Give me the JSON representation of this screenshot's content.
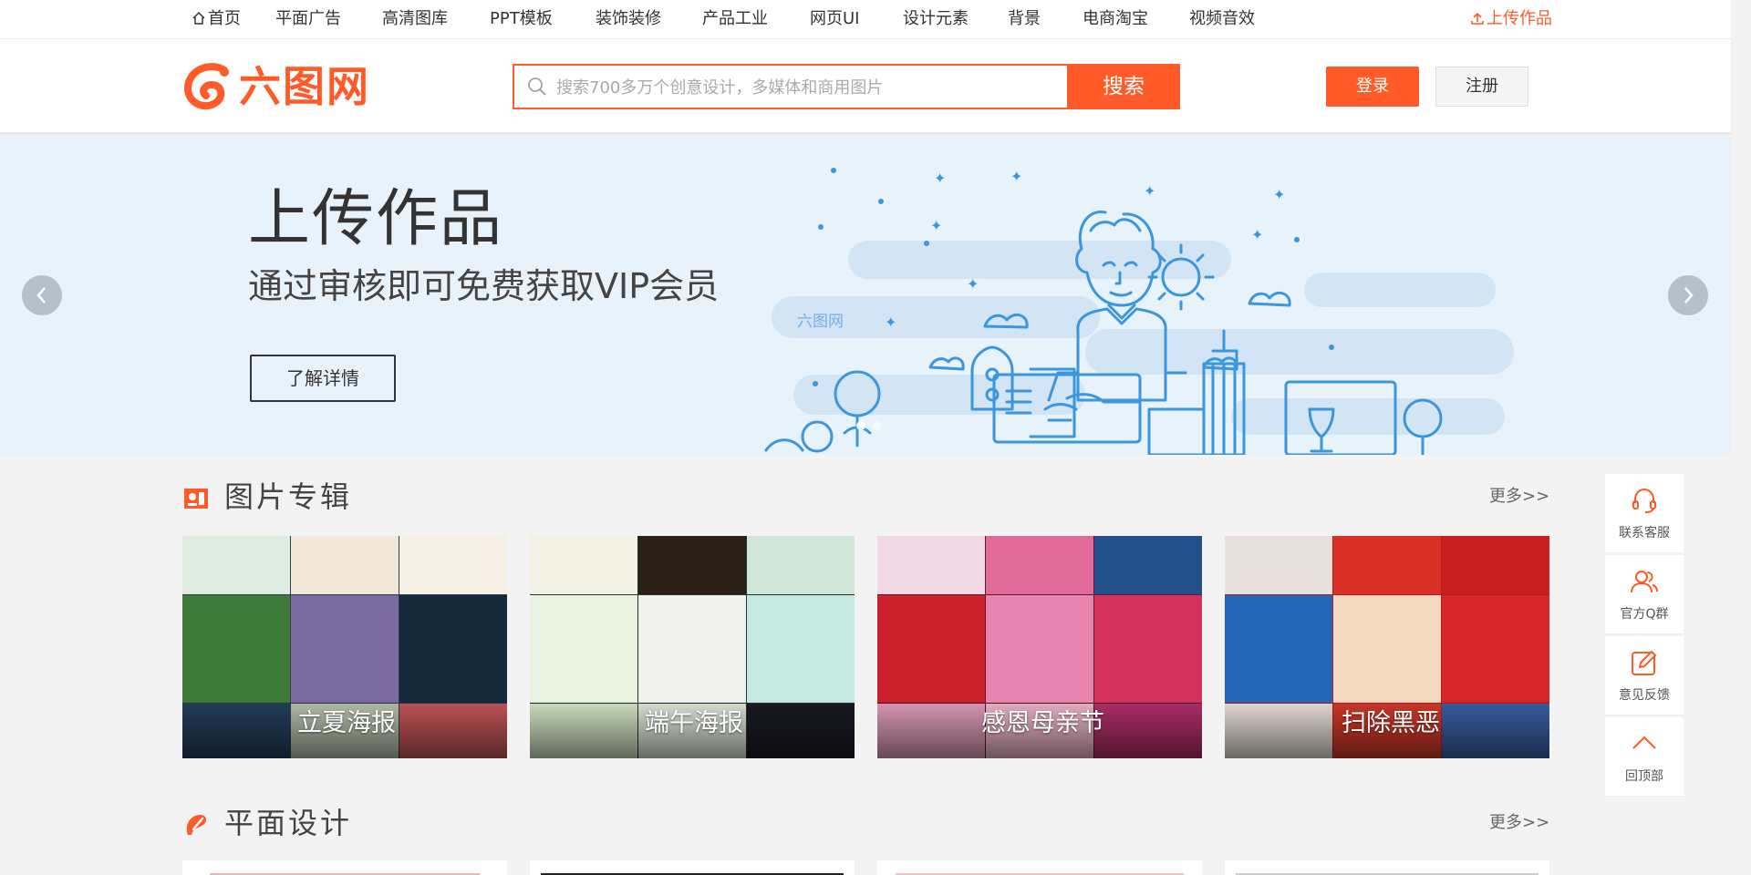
{
  "nav": {
    "items": [
      {
        "label": "首页"
      },
      {
        "label": "平面广告"
      },
      {
        "label": "高清图库"
      },
      {
        "label": "PPT模板"
      },
      {
        "label": "装饰装修"
      },
      {
        "label": "产品工业"
      },
      {
        "label": "网页UI"
      },
      {
        "label": "设计元素"
      },
      {
        "label": "背景"
      },
      {
        "label": "电商淘宝"
      },
      {
        "label": "视频音效"
      }
    ],
    "upload_label": "上传作品"
  },
  "header": {
    "logo_text": "六图网",
    "search_placeholder": "搜索700多万个创意设计，多媒体和商用图片",
    "search_button": "搜索",
    "login_button": "登录",
    "register_button": "注册"
  },
  "banner": {
    "title": "上传作品",
    "subtitle": "通过审核即可免费获取VIP会员",
    "button": "了解详情",
    "art_logo": "六图网"
  },
  "sections": [
    {
      "title": "图片专辑",
      "more": "更多>>"
    },
    {
      "title": "平面设计",
      "more": "更多>>"
    }
  ],
  "albums": [
    {
      "label": "立夏海报"
    },
    {
      "label": "端午海报"
    },
    {
      "label": "感恩母亲节"
    },
    {
      "label": "扫除黑恶"
    }
  ],
  "sidebar": [
    {
      "label": "联系客服",
      "icon": "headset-icon"
    },
    {
      "label": "官方Q群",
      "icon": "users-icon"
    },
    {
      "label": "意见反馈",
      "icon": "edit-icon"
    },
    {
      "label": "回顶部",
      "icon": "chevron-up-icon"
    }
  ],
  "colors": {
    "accent": "#ff5a28",
    "banner_bg": "#e8f2fa",
    "illustration_blue": "#3a97dd"
  }
}
